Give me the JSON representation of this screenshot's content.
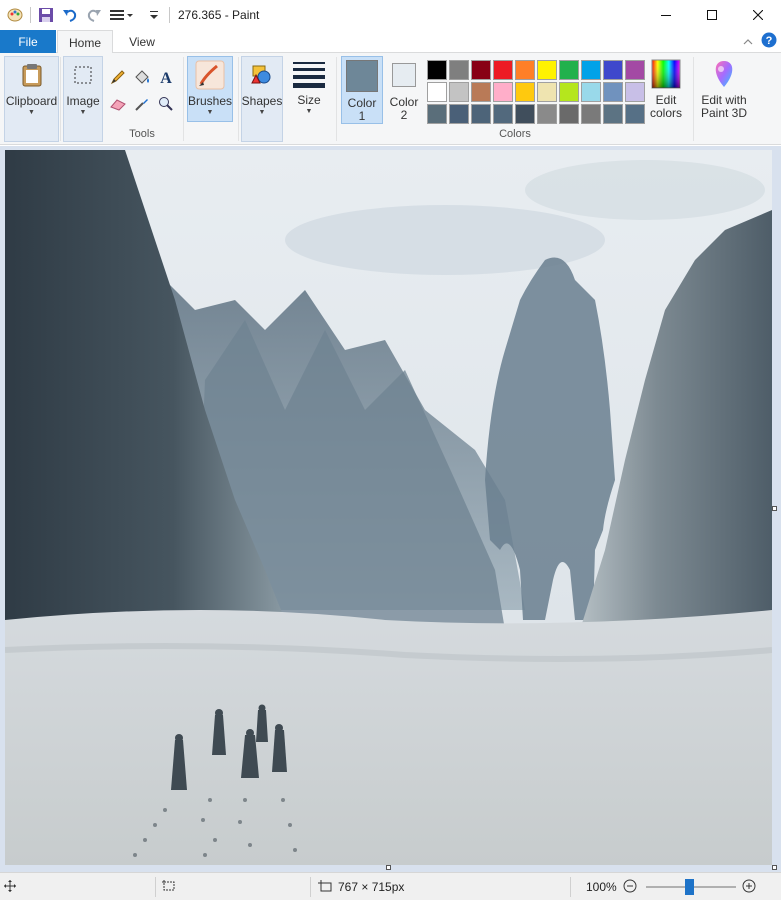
{
  "window": {
    "title": "276.365 - Paint",
    "icons": [
      "paint-app-icon",
      "save-icon",
      "undo-icon",
      "redo-icon",
      "customize-qat-icon"
    ]
  },
  "tabs": {
    "file": "File",
    "home": "Home",
    "view": "View"
  },
  "ribbon": {
    "clipboard": "Clipboard",
    "image": "Image",
    "tools": "Tools",
    "brushes": "Brushes",
    "shapes": "Shapes",
    "size": "Size",
    "color1": "Color 1",
    "color1_l1": "Color",
    "color1_l2": "1",
    "color2_l1": "Color",
    "color2_l2": "2",
    "colors_group": "Colors",
    "edit_colors_l1": "Edit",
    "edit_colors_l2": "colors",
    "paint3d_l1": "Edit with",
    "paint3d_l2": "Paint 3D",
    "color1_value": "#6e8798",
    "color2_value": "#e6ecf1"
  },
  "palette": [
    "#000000",
    "#7f7f7f",
    "#880015",
    "#ed1c24",
    "#ff7f27",
    "#fff200",
    "#22b14c",
    "#00a2e8",
    "#3f48cc",
    "#a349a4",
    "#ffffff",
    "#c3c3c3",
    "#b97a57",
    "#ffaec9",
    "#ffc90e",
    "#efe4b0",
    "#b5e61d",
    "#99d9ea",
    "#7092be",
    "#c8bfe7",
    "#5a6e7a",
    "#4a6078",
    "#4d6479",
    "#52697d",
    "#404e5c",
    "#8a8a8a",
    "#6a6a6a",
    "#7a7a7a",
    "#5c7383",
    "#567086"
  ],
  "status": {
    "canvas_size": "767 × 715px",
    "zoom": "100%",
    "zoom_level": 0.48
  }
}
